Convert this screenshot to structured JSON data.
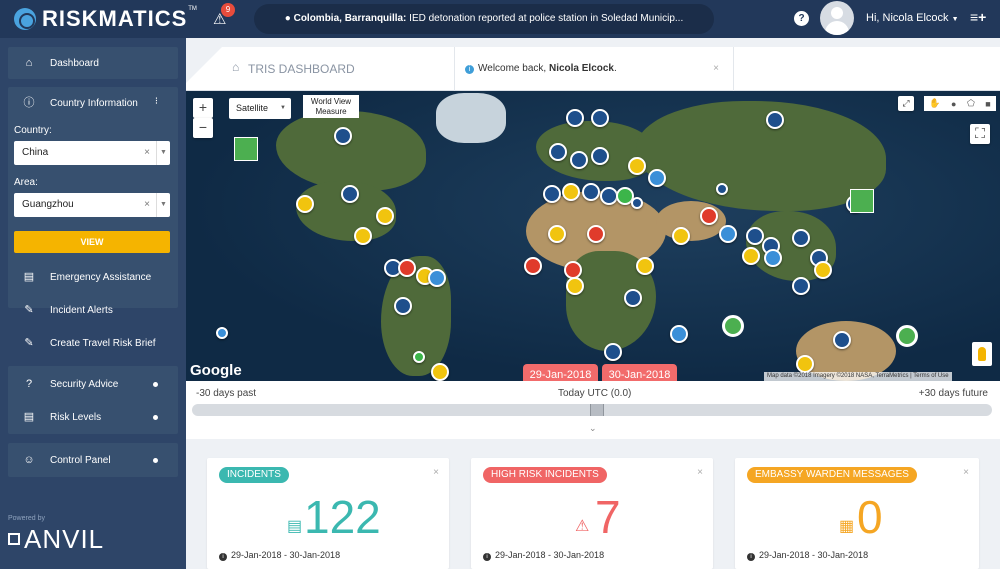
{
  "app": {
    "name": "RISKMATICS",
    "trademark": "TM"
  },
  "alerts": {
    "count": "9"
  },
  "ticker": {
    "location": "Colombia, Barranquilla:",
    "text": "IED detonation reported at police station in Soledad Municip..."
  },
  "user": {
    "greeting": "Hi, Nicola Elcock"
  },
  "sidebar": {
    "dashboard": "Dashboard",
    "country_information": "Country Information",
    "country_label": "Country:",
    "country_value": "China",
    "area_label": "Area:",
    "area_value": "Guangzhou",
    "view_button": "VIEW",
    "items": [
      {
        "label": "Emergency Assistance"
      },
      {
        "label": "Incident Alerts"
      },
      {
        "label": "Create Travel Risk Brief"
      },
      {
        "label": "Security Advice"
      },
      {
        "label": "Risk Levels"
      },
      {
        "label": "Control Panel"
      }
    ],
    "powered_by": "Powered by",
    "brand": "ANVIL"
  },
  "header": {
    "title": "TRIS DASHBOARD",
    "welcome_prefix": "Welcome back,",
    "welcome_name": "Nicola Elcock",
    "welcome_suffix": "."
  },
  "map": {
    "zoom_in": "+",
    "zoom_out": "−",
    "map_type": "Satellite",
    "measure_line1": "World View",
    "measure_line2": "Measure",
    "google": "Google",
    "attribution": "Map data ©2018 Imagery ©2018 NASA, TerraMetrics",
    "terms": "Terms of Use",
    "date_from": "29-Jan-2018",
    "date_to": "30-Jan-2018"
  },
  "timeline": {
    "past": "-30 days past",
    "today": "Today UTC (0.0)",
    "future": "+30 days future"
  },
  "cards": [
    {
      "label": "INCIDENTS",
      "value": "122",
      "range": "29-Jan-2018 - 30-Jan-2018",
      "color": "#3bb8b0"
    },
    {
      "label": "HIGH RISK INCIDENTS",
      "value": "7",
      "range": "29-Jan-2018 - 30-Jan-2018",
      "color": "#f06565"
    },
    {
      "label": "EMBASSY WARDEN MESSAGES",
      "value": "0",
      "range": "29-Jan-2018 - 30-Jan-2018",
      "color": "#f5a623"
    }
  ]
}
